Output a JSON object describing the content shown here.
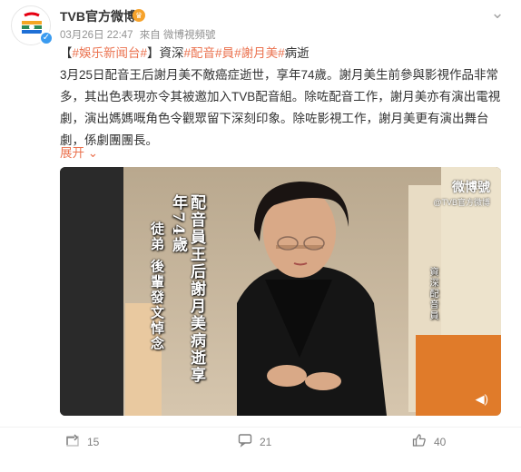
{
  "post": {
    "user": {
      "name": "TVB官方微博"
    },
    "meta": {
      "date": "03月26日 22:47",
      "source": "來自 微博視頻號"
    },
    "text": {
      "seg1": "【",
      "tag1": "#娛乐新闻台#",
      "seg2": "】資深",
      "tag2": "#配音",
      "tag3": "#員",
      "tag4": "#謝月美",
      "tag5": "#",
      "seg3": "病逝",
      "body": "3月25日配音王后謝月美不敵癌症逝世，享年74歲。謝月美生前參與影視作品非常多，其出色表現亦令其被邀加入TVB配音組。除咗配音工作，謝月美亦有演出電視劇，演出媽媽嘅角色令觀眾留下深刻印象。除咗影視工作，謝月美更有演出舞台劇，係劇團團長。"
    },
    "expand_label": "展开 ⌄",
    "video": {
      "caption_main": "配音員王后謝月美病逝享年74歲",
      "caption_sub": "徒弟 後輩發文悼念",
      "caption_name": "資深配音員",
      "watermark_logo": "微博號",
      "watermark_text": "@TVB官方微博"
    },
    "actions": {
      "repost": "15",
      "comment": "21",
      "like": "40"
    }
  },
  "colors": {
    "accent": "#eb7350",
    "verified": "#3a9bf0"
  }
}
